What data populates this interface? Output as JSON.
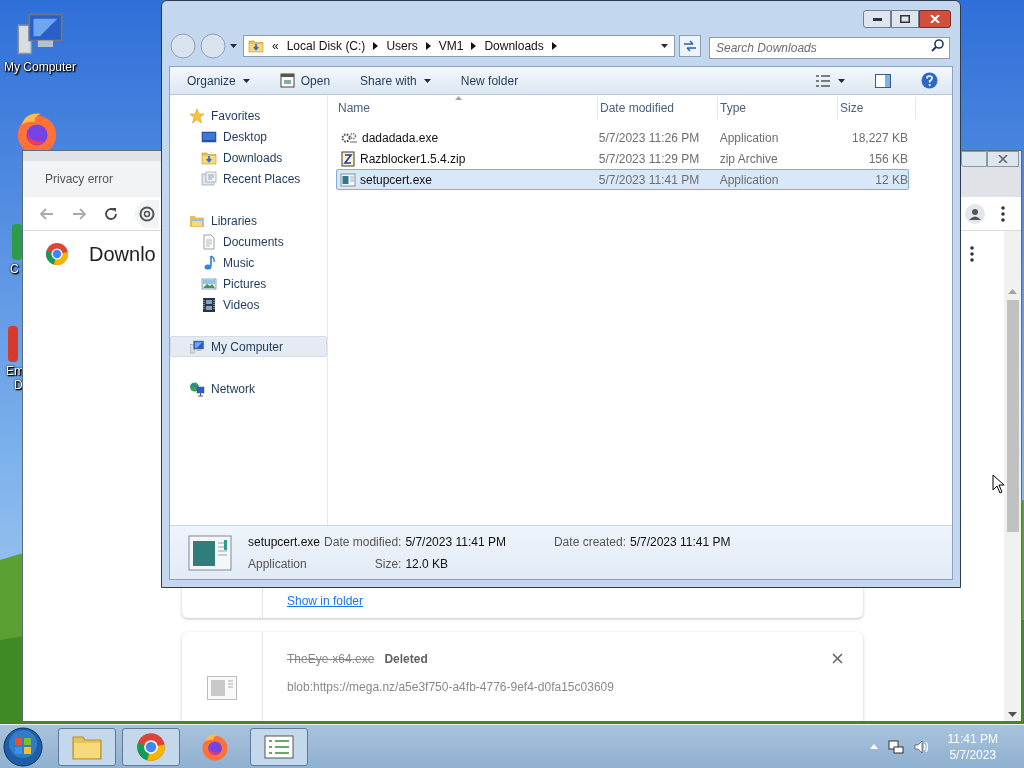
{
  "desktop": {
    "icons": [
      {
        "kind": "computer",
        "label": "My Computer"
      },
      {
        "kind": "firefox"
      },
      {
        "kind": "green-app",
        "label": "C"
      },
      {
        "kind": "red-app",
        "label": "Em",
        "label_2": "D"
      }
    ]
  },
  "browser": {
    "tab_title": "Privacy error",
    "heading": "Downlo",
    "downloads": [
      {
        "kind": "link-only",
        "link": "Show in folder"
      },
      {
        "kind": "file",
        "filename": "TheEye-x64.exe",
        "status": "Deleted",
        "deleted": true,
        "url": "blob:https://mega.nz/a5e3f750-a4fb-4776-9ef4-d0fa15c03609"
      }
    ]
  },
  "explorer": {
    "breadcrumb": {
      "overflow": "«",
      "parts": [
        "Local Disk (C:)",
        "Users",
        "VM1",
        "Downloads"
      ]
    },
    "search": {
      "placeholder": "Search Downloads"
    },
    "toolbar": [
      {
        "kind": "menu",
        "label": "Organize"
      },
      {
        "kind": "open",
        "label": "Open"
      },
      {
        "kind": "menu",
        "label": "Share with"
      },
      {
        "kind": "plain",
        "label": "New folder"
      }
    ],
    "nav": [
      {
        "kind": "star",
        "label": "Favorites",
        "selected": false,
        "children": [
          {
            "kind": "desktop",
            "label": "Desktop",
            "selected": false
          },
          {
            "kind": "download-folder",
            "label": "Downloads",
            "selected": false
          },
          {
            "kind": "recent",
            "label": "Recent Places",
            "selected": false
          }
        ]
      },
      {
        "kind": "library",
        "label": "Libraries",
        "selected": false,
        "children": [
          {
            "kind": "document",
            "label": "Documents",
            "selected": false
          },
          {
            "kind": "music",
            "label": "Music",
            "selected": false
          },
          {
            "kind": "pictures",
            "label": "Pictures",
            "selected": false
          },
          {
            "kind": "video",
            "label": "Videos",
            "selected": false
          }
        ]
      },
      {
        "kind": "computer",
        "label": "My Computer",
        "selected": true
      },
      {
        "kind": "network",
        "label": "Network",
        "selected": false
      }
    ],
    "columns": [
      "Name",
      "Date modified",
      "Type",
      "Size"
    ],
    "files": [
      {
        "kind": "gear-app",
        "name": "dadadada.exe",
        "date": "5/7/2023 11:26 PM",
        "type": "Application",
        "size": "18,227 KB",
        "selected": false
      },
      {
        "kind": "zip",
        "name": "Razblocker1.5.4.zip",
        "date": "5/7/2023 11:29 PM",
        "type": "zip Archive",
        "size": "156 KB",
        "selected": false
      },
      {
        "kind": "app",
        "name": "setupcert.exe",
        "date": "5/7/2023 11:41 PM",
        "type": "Application",
        "size": "12 KB",
        "selected": true
      }
    ],
    "details": {
      "name": "setupcert.exe",
      "type": "Application",
      "fields": [
        {
          "label": "Date modified:",
          "value": "5/7/2023 11:41 PM"
        },
        {
          "label": "Size:",
          "value": "12.0 KB"
        },
        {
          "label": "Date created:",
          "value": "5/7/2023 11:41 PM"
        }
      ]
    }
  },
  "taskbar": {
    "apps": [
      {
        "kind": "explorer",
        "running": true
      },
      {
        "kind": "chrome",
        "running": true
      },
      {
        "kind": "firefox",
        "running": false
      },
      {
        "kind": "notes",
        "running": true
      }
    ],
    "clock": {
      "time": "11:41 PM",
      "date": "5/7/2023"
    }
  }
}
